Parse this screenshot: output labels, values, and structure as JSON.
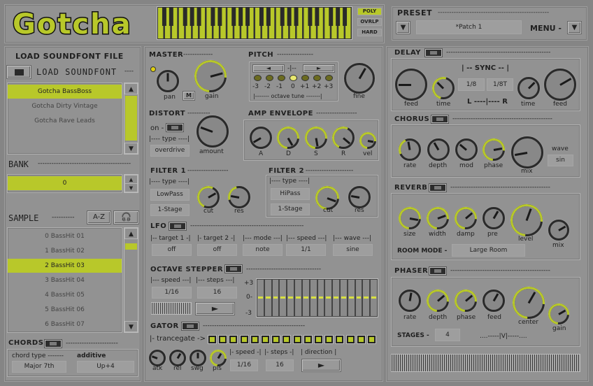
{
  "app": {
    "logo_text": "Gotcha",
    "poly": "POLY",
    "ovrlp": "OVRLP",
    "hard": "HARD"
  },
  "preset": {
    "title": "PRESET",
    "name": "*Patch 1",
    "menu_label": "MENU -"
  },
  "soundfont": {
    "title": "LOAD SOUNDFONT FILE",
    "load_label": "LOAD SOUNDFONT",
    "items": [
      "Gotcha BassBoss",
      "Gotcha Dirty Vintage",
      "Gotcha Rave Leads"
    ],
    "selected_index": 0
  },
  "bank": {
    "title": "BANK",
    "value": "0"
  },
  "sample": {
    "title": "SAMPLE",
    "az_label": "A-Z",
    "items": [
      "0 BassHit 01",
      "1 BassHit 02",
      "2 BassHit 03",
      "3 BassHit 04",
      "4 BassHit 05",
      "5 BassHit 06",
      "6 BassHit 07"
    ],
    "selected_index": 2
  },
  "chords": {
    "title": "CHORDS",
    "type_label": "chord type -------",
    "type_value": "Major 7th",
    "additive_label": "additive",
    "additive_value": "Up+4"
  },
  "master": {
    "title": "MASTER",
    "pan_label": "pan",
    "m_label": "M",
    "gain_label": "gain"
  },
  "pitch": {
    "title": "PITCH",
    "left_arrow": "◄",
    "right_arrow": "►",
    "center_mark": "-|--",
    "octaves": [
      "-3",
      "-2",
      "-1",
      "0",
      "+1",
      "+2",
      "+3"
    ],
    "octave_label": "|------- octave tune -------|",
    "fine_label": "fine"
  },
  "distort": {
    "title": "DISTORT",
    "on_label": "on -",
    "type_label": "|---- type ----|",
    "type_value": "overdrive",
    "amount_label": "amount"
  },
  "amp_envelope": {
    "title": "AMP ENVELOPE",
    "labels": [
      "A",
      "D",
      "S",
      "R",
      "vel"
    ]
  },
  "filter1": {
    "title": "FILTER 1",
    "type_label": "|---- type ----|",
    "type_value": "LowPass",
    "stage_value": "1-Stage",
    "cut_label": "cut",
    "res_label": "res"
  },
  "filter2": {
    "title": "FILTER 2",
    "type_label": "|---- type ----|",
    "type_value": "HiPass",
    "stage_value": "1-Stage",
    "cut_label": "cut",
    "res_label": "res"
  },
  "lfo": {
    "title": "LFO",
    "target1_label": "|-- target 1 -|",
    "target1_value": "off",
    "target2_label": "|- target 2 -|",
    "target2_value": "off",
    "mode_label": "|--- mode ---|",
    "mode_value": "note",
    "speed_label": "|--- speed ---|",
    "speed_value": "1/1",
    "wave_label": "|--- wave ---|",
    "wave_value": "sine"
  },
  "octave_stepper": {
    "title": "OCTAVE STEPPER",
    "speed_label": "|--- speed ---|",
    "speed_value": "1/16",
    "steps_label": "|--- steps ---|",
    "steps_value": "16",
    "scale_top": "+3",
    "scale_mid": "0-",
    "scale_bot": "-3",
    "step_count": 16
  },
  "gator": {
    "title": "GATOR",
    "trancegate_label": "|- trancegate ->",
    "knob_labels": [
      "atk",
      "rel",
      "swg",
      "pls"
    ],
    "speed_label": "|- speed -|",
    "speed_value": "1/16",
    "steps_label": "|- steps -|",
    "steps_value": "16",
    "direction_label": "| direction |"
  },
  "delay": {
    "title": "DELAY",
    "sync_label": "| -- SYNC -- |",
    "sync_a": "1/8",
    "sync_b": "1/8T",
    "lr_label": "L ----|---- R",
    "labels": [
      "feed",
      "time",
      "time",
      "feed"
    ]
  },
  "chorus": {
    "title": "CHORUS",
    "labels": [
      "rate",
      "depth",
      "mod",
      "phase",
      "mix"
    ],
    "wave_label": "wave",
    "wave_value": "sin"
  },
  "reverb": {
    "title": "REVERB",
    "labels": [
      "size",
      "width",
      "damp",
      "pre",
      "level",
      "mix"
    ],
    "room_label": "ROOM MODE -",
    "room_value": "Large Room"
  },
  "phaser": {
    "title": "PHASER",
    "labels": [
      "rate",
      "depth",
      "phase",
      "feed",
      "center",
      "gain"
    ],
    "stages_label": "STAGES -",
    "stages_value": "4",
    "bottom_label": "....-----|V|-----...."
  },
  "colors": {
    "accent": "#b8c82a",
    "background": "#858585",
    "dark": "#2a2a2a"
  }
}
